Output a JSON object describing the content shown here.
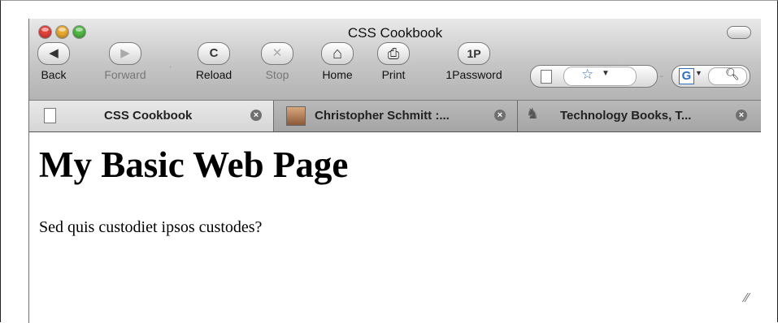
{
  "window": {
    "title": "CSS Cookbook"
  },
  "toolbar": {
    "back": {
      "label": "Back",
      "glyph": "◀"
    },
    "forward": {
      "label": "Forward",
      "glyph": "▶"
    },
    "reload": {
      "label": "Reload",
      "glyph": "C"
    },
    "stop": {
      "label": "Stop",
      "glyph": "✕"
    },
    "home": {
      "label": "Home",
      "glyph": "⌂"
    },
    "print": {
      "label": "Print",
      "glyph": "⎙"
    },
    "onepassword": {
      "label": "1Password",
      "glyph": "1P"
    },
    "search_engine_glyph": "G"
  },
  "tabs": [
    {
      "title": "CSS Cookbook",
      "icon": "page-icon"
    },
    {
      "title": "Christopher Schmitt :...",
      "icon": "photo-favicon"
    },
    {
      "title": "Technology Books, T...",
      "icon": "oreilly-favicon"
    }
  ],
  "page": {
    "heading": "My Basic Web Page",
    "paragraph": "Sed quis custodiet ipsos custodes?"
  },
  "colors": {
    "close_red": "#e0413a",
    "minimize_yellow": "#e6a82e",
    "zoom_green": "#4fb644",
    "bookmark_star": "#3a73c9"
  }
}
